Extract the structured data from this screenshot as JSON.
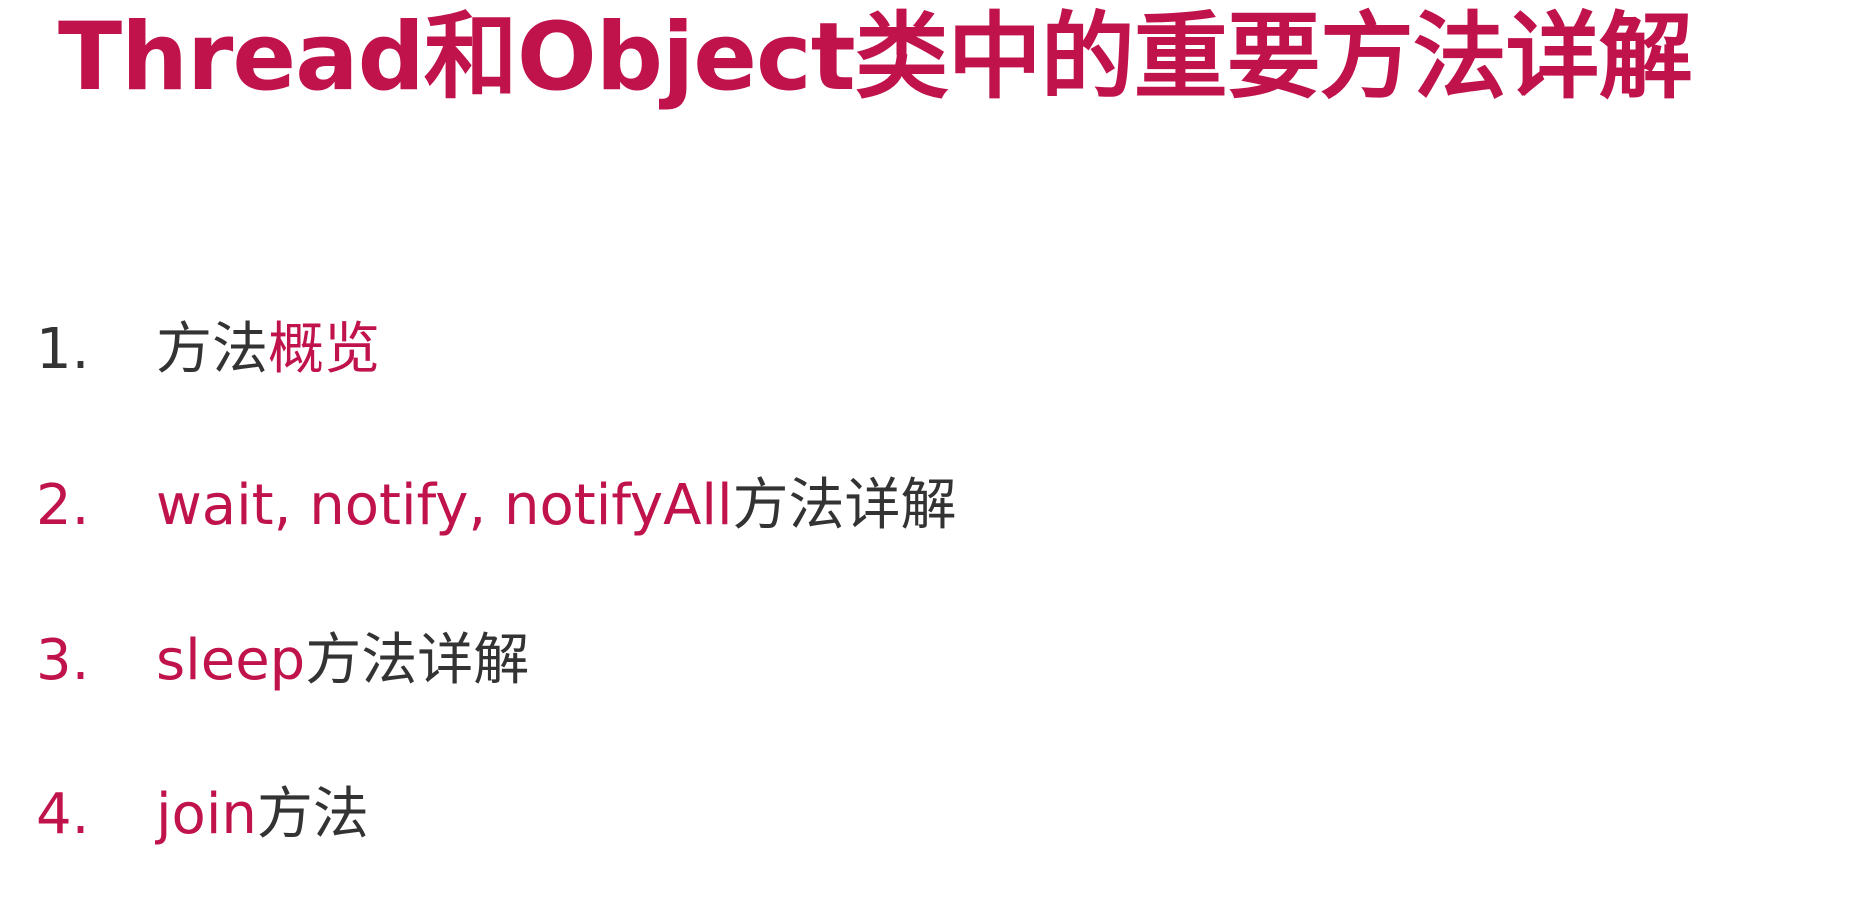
{
  "slide": {
    "title": "Thread和Object类中的重要方法详解",
    "items": [
      {
        "number": "1.",
        "parts": [
          "方法",
          "概览"
        ]
      },
      {
        "number": "2.",
        "parts": [
          "wait, notify, notifyAll",
          "方法详解"
        ]
      },
      {
        "number": "3.",
        "parts": [
          "sleep",
          "方法详解"
        ]
      },
      {
        "number": "4.",
        "parts": [
          "join",
          "方法"
        ]
      }
    ]
  },
  "colors": {
    "accent": "#c0134b",
    "text": "#333333",
    "background": "#ffffff"
  }
}
